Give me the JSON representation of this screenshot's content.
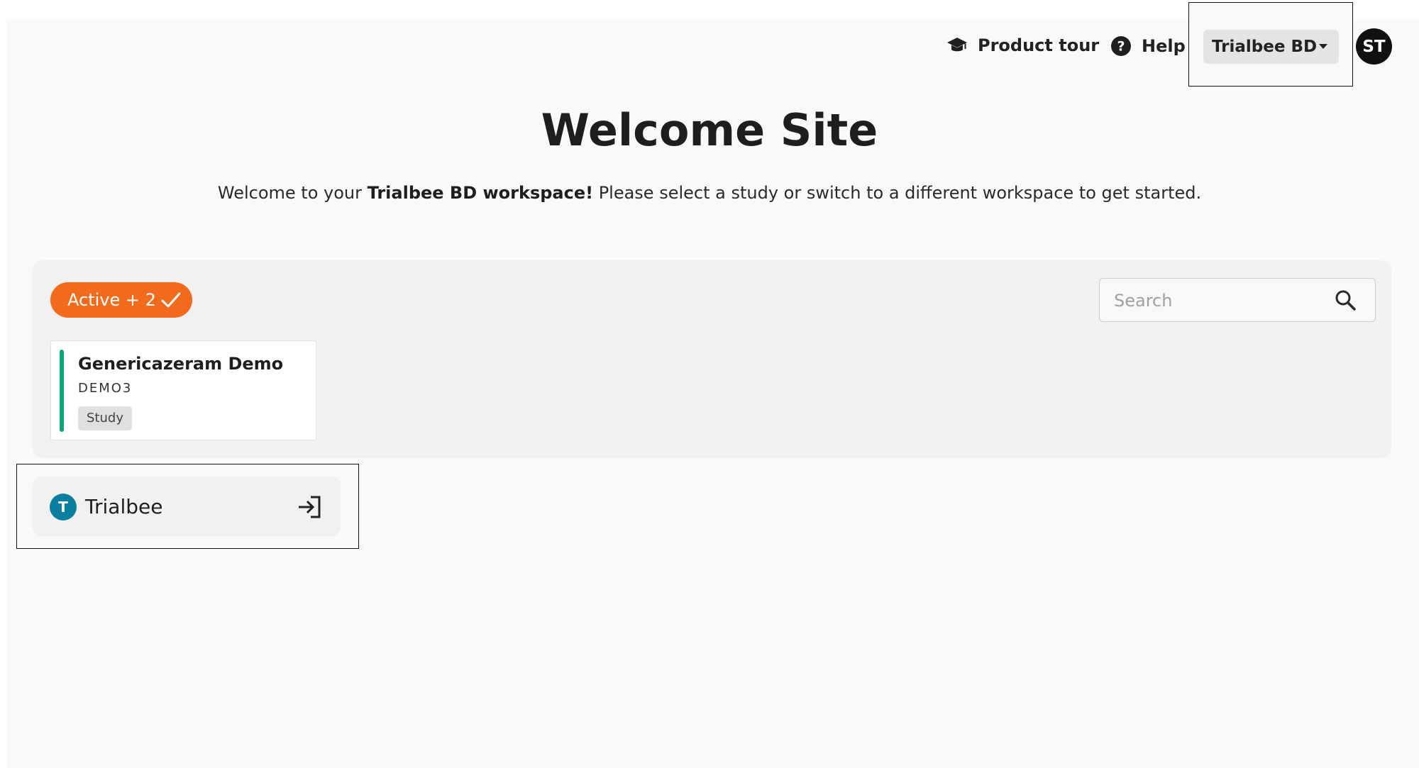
{
  "header": {
    "product_tour": {
      "label": "Product tour",
      "icon": "graduation-cap-icon"
    },
    "help": {
      "label": "Help",
      "icon": "help-circle-icon"
    },
    "workspace_select": {
      "label": "Trialbee BD",
      "icon": "caret-down-icon"
    },
    "avatar": {
      "initials": "ST"
    }
  },
  "welcome": {
    "title": "Welcome Site",
    "message_prefix": "Welcome to your ",
    "message_workspace": "Trialbee BD workspace!",
    "message_suffix": " Please select a study or switch to a different workspace to get started."
  },
  "studies": {
    "filter": {
      "label": "Active + 2",
      "icon": "checkmark-icon",
      "color": "#f26b1c"
    },
    "search": {
      "placeholder": "Search",
      "value": "",
      "icon": "search-icon"
    },
    "items": [
      {
        "name": "Genericazeram Demo",
        "code": "DEMO3",
        "type": "Study",
        "accent_color": "#10a37a"
      }
    ]
  },
  "workspaces": {
    "items": [
      {
        "badge": "T",
        "name": "Trialbee",
        "icon": "enter-icon",
        "badge_color": "#0a7f9e"
      }
    ]
  }
}
